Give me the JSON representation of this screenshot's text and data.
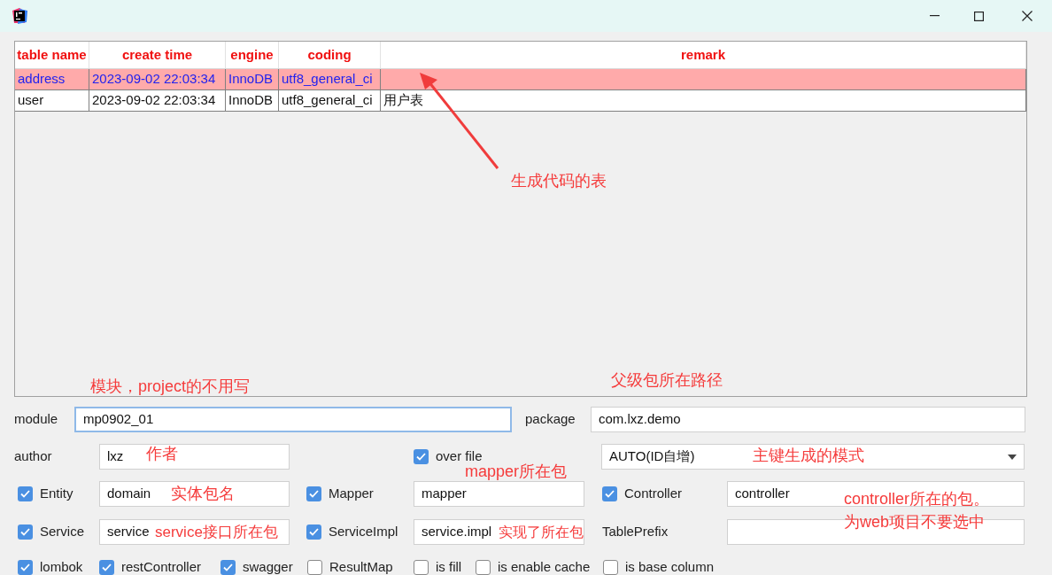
{
  "table": {
    "columns": [
      "table name",
      "create time",
      "engine",
      "coding",
      "remark"
    ],
    "rows": [
      {
        "selected": true,
        "cells": [
          "address",
          "2023-09-02 22:03:34",
          "InnoDB",
          "utf8_general_ci"
        ]
      },
      {
        "selected": false,
        "cells": [
          "user",
          "2023-09-02 22:03:34",
          "InnoDB",
          "utf8_general_ci",
          "用户表"
        ]
      }
    ]
  },
  "module": {
    "label": "module",
    "value": "mp0902_01",
    "focused": true
  },
  "package": {
    "label": "package",
    "value": "com.lxz.demo",
    "focused": false
  },
  "author": {
    "label": "author",
    "value": "lxz",
    "focused": false
  },
  "over_file": {
    "label": "over file",
    "checked": true
  },
  "id_type": {
    "value": "AUTO(ID自增)"
  },
  "package_rows": [
    [
      {
        "kind": "check",
        "label": "Entity",
        "checked": true,
        "value": "domain"
      },
      {
        "kind": "check",
        "label": "Mapper",
        "checked": true,
        "value": "mapper"
      },
      {
        "kind": "check",
        "label": "Controller",
        "checked": true,
        "value": "controller"
      }
    ],
    [
      {
        "kind": "check",
        "label": "Service",
        "checked": true,
        "value": "service"
      },
      {
        "kind": "check",
        "label": "ServiceImpl",
        "checked": true,
        "value": "service.impl"
      },
      {
        "kind": "plain",
        "label": "TablePrefix"
      }
    ]
  ],
  "options": [
    {
      "label": "lombok",
      "checked": true
    },
    {
      "label": "restController",
      "checked": true
    },
    {
      "label": "swagger",
      "checked": true
    },
    {
      "label": "ResultMap",
      "checked": false
    },
    {
      "label": "is fill",
      "checked": false
    },
    {
      "label": "is enable cache",
      "checked": false
    },
    {
      "label": "is base column",
      "checked": false
    }
  ],
  "annotations": [
    {
      "text": "生成代码的表"
    },
    {
      "text": "模块，project的不用写"
    },
    {
      "text": "父级包所在路径"
    },
    {
      "text": "作者"
    },
    {
      "text": "主键生成的模式"
    },
    {
      "text": "实体包名"
    },
    {
      "text": "mapper所在包"
    },
    {
      "text": "service接口所在包"
    },
    {
      "text": "实现了所在包"
    },
    {
      "text": "controller所在的包。"
    },
    {
      "text": "为web项目不要选中"
    }
  ]
}
